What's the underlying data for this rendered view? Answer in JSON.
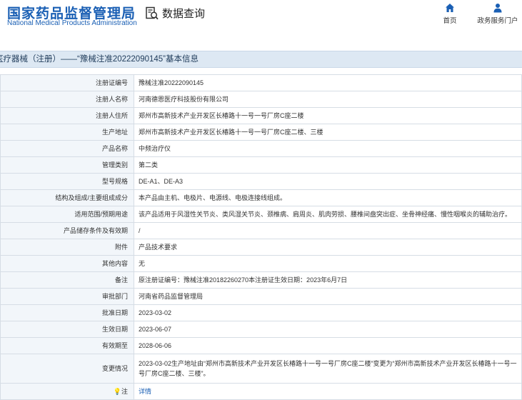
{
  "header": {
    "logo_cn": "国家药品监督管理局",
    "logo_en": "National Medical Products Administration",
    "section_title": "数据查询",
    "section_icon": "document-search-icon",
    "nav": [
      {
        "label": "首页",
        "icon": "home-icon"
      },
      {
        "label": "政务服务门户",
        "icon": "user-icon"
      }
    ]
  },
  "title_bar": "医疗器械（注册）——“豫械注准20222090145”基本信息",
  "rows": [
    {
      "label": "注册证编号",
      "value": "豫械注准20222090145"
    },
    {
      "label": "注册人名称",
      "value": "河南德恩医疗科技股份有限公司"
    },
    {
      "label": "注册人住所",
      "value": "郑州市高新技术产业开发区长椿路十一号一号厂房C座二楼"
    },
    {
      "label": "生产地址",
      "value": "郑州市高新技术产业开发区长椿路十一号一号厂房C座二楼、三楼"
    },
    {
      "label": "产品名称",
      "value": "中频治疗仪"
    },
    {
      "label": "管理类别",
      "value": "第二类"
    },
    {
      "label": "型号规格",
      "value": "DE-A1、DE-A3"
    },
    {
      "label": "结构及组成/主要组成成分",
      "value": "本产品由主机、电极片、电源线、电极连接线组成。"
    },
    {
      "label": "适用范围/预期用途",
      "value": "该产品适用于风湿性关节炎、类风湿关节炎、颈椎病、肩周炎、肌肉劳损、腰椎间盘突出症、坐骨神经痛、慢性咽喉炎的辅助治疗。"
    },
    {
      "label": "产品储存条件及有效期",
      "value": "/"
    },
    {
      "label": "附件",
      "value": "产品技术要求"
    },
    {
      "label": "其他内容",
      "value": "无"
    },
    {
      "label": "备注",
      "value": "原注册证编号：豫械注准20182260270本注册证生效日期：2023年6月7日"
    },
    {
      "label": "审批部门",
      "value": "河南省药品监督管理局"
    },
    {
      "label": "批准日期",
      "value": "2023-03-02"
    },
    {
      "label": "生效日期",
      "value": "2023-06-07"
    },
    {
      "label": "有效期至",
      "value": "2028-06-06"
    },
    {
      "label": "变更情况",
      "value": "2023-03-02生产地址由“郑州市高新技术产业开发区长椿路十一号一号厂房C座二楼”变更为“郑州市高新技术产业开发区长椿路十一号一号厂房C座二楼、三楼”。"
    }
  ],
  "note": {
    "label": "注",
    "icon": "lamp-icon",
    "link_text": "详情"
  }
}
